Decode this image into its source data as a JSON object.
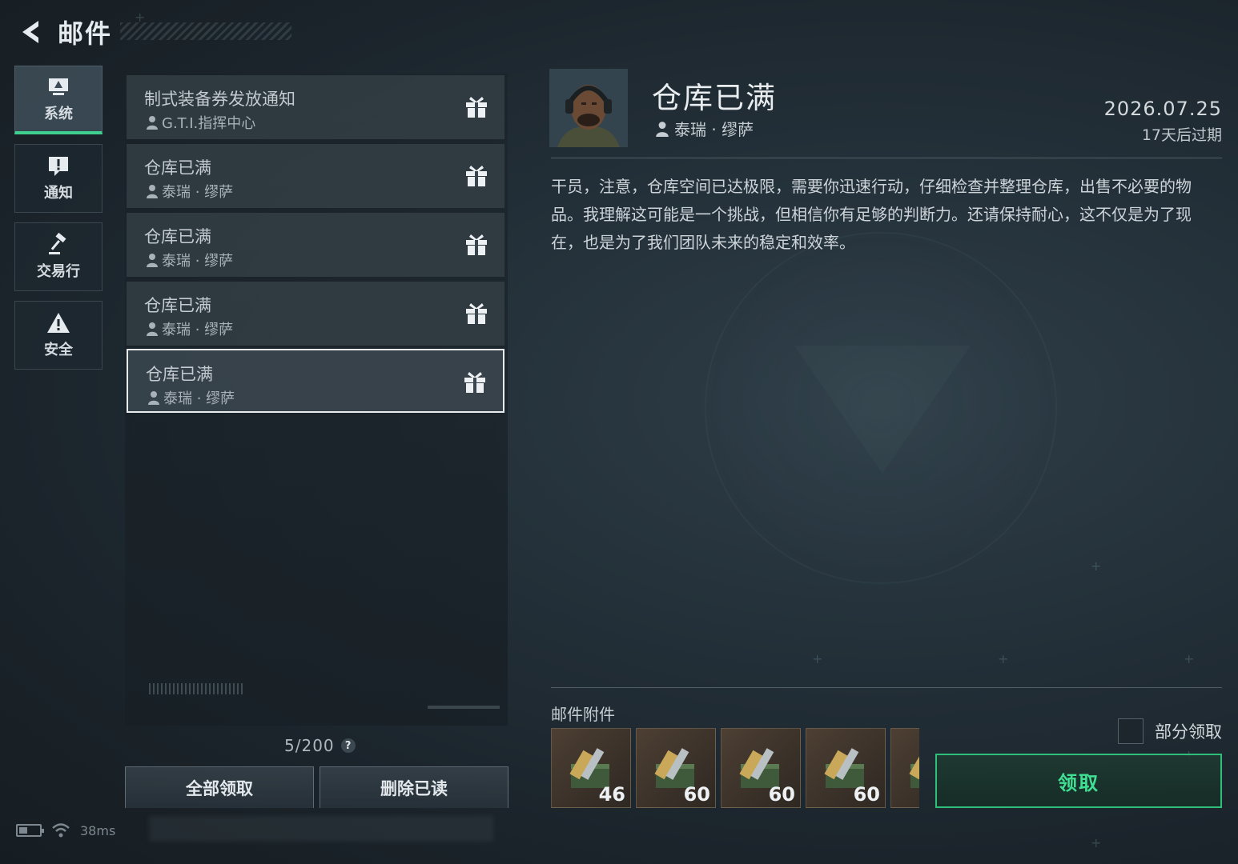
{
  "header": {
    "title": "邮件"
  },
  "sidenav": [
    {
      "label": "系统",
      "icon": "system-monitor-icon",
      "active": true
    },
    {
      "label": "通知",
      "icon": "notice-icon",
      "active": false
    },
    {
      "label": "交易行",
      "icon": "auction-hammer-icon",
      "active": false
    },
    {
      "label": "安全",
      "icon": "warning-triangle-icon",
      "active": false
    }
  ],
  "mails": [
    {
      "title": "制式装备券发放通知",
      "sender": "G.T.I.指挥中心",
      "icon": "gift-icon"
    },
    {
      "title": "仓库已满",
      "sender": "泰瑞 · 缪萨",
      "icon": "gift-icon"
    },
    {
      "title": "仓库已满",
      "sender": "泰瑞 · 缪萨",
      "icon": "gift-icon"
    },
    {
      "title": "仓库已满",
      "sender": "泰瑞 · 缪萨",
      "icon": "gift-icon"
    },
    {
      "title": "仓库已满",
      "sender": "泰瑞 · 缪萨",
      "icon": "gift-icon",
      "selected": true
    }
  ],
  "mail_count": "5/200",
  "help_label": "?",
  "buttons": {
    "claim_all": "全部领取",
    "delete_read": "删除已读",
    "claim": "领取",
    "partial_claim": "部分领取"
  },
  "status": {
    "ping": "38ms"
  },
  "detail": {
    "title": "仓库已满",
    "sender": "泰瑞 · 缪萨",
    "date": "2026.07.25",
    "expiry": "17天后过期",
    "body": "干员，注意，仓库空间已达极限，需要你迅速行动，仔细检查并整理仓库，出售不必要的物品。我理解这可能是一个挑战，但相信你有足够的判断力。还请保持耐心，这不仅是为了现在，也是为了我们团队未来的稳定和效率。",
    "attachments_label": "邮件附件",
    "attachments": [
      {
        "qty": "46",
        "icon": "ammo-box-icon"
      },
      {
        "qty": "60",
        "icon": "ammo-box-icon"
      },
      {
        "qty": "60",
        "icon": "ammo-box-icon"
      },
      {
        "qty": "60",
        "icon": "ammo-box-icon"
      },
      {
        "qty": "",
        "icon": "ammo-box-icon"
      }
    ]
  },
  "colors": {
    "accent_green": "#3fe094",
    "selected_border": "#e8ecef"
  }
}
